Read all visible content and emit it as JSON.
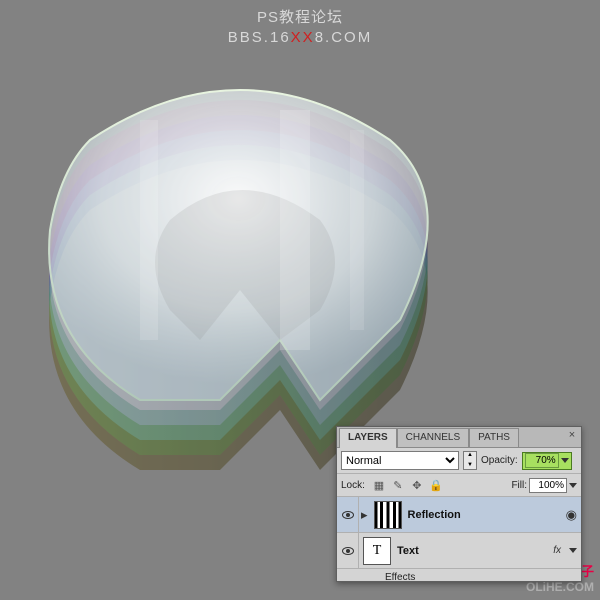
{
  "header": {
    "title": "PS教程论坛",
    "url_pre": "BBS.16",
    "url_mid": "XX",
    "url_post": "8.COM"
  },
  "watermark_right": {
    "brand": "活力盒子",
    "site": "OLiHE.COM"
  },
  "panel": {
    "close": "×",
    "tabs": [
      "LAYERS",
      "CHANNELS",
      "PATHS"
    ],
    "blend_mode": "Normal",
    "opacity_label": "Opacity:",
    "opacity_value": "70%",
    "lock_label": "Lock:",
    "fill_label": "Fill:",
    "fill_value": "100%",
    "layers": [
      {
        "name": "Reflection",
        "type": "smart",
        "selected": true
      },
      {
        "name": "Text",
        "type": "type",
        "selected": false,
        "fx": "fx"
      }
    ],
    "effects_label": "Effects"
  },
  "artwork": {
    "colors": [
      "#6a5f2f",
      "#3f7a3f",
      "#2f6a7a",
      "#5a3f8a",
      "#8f3f7a"
    ]
  }
}
